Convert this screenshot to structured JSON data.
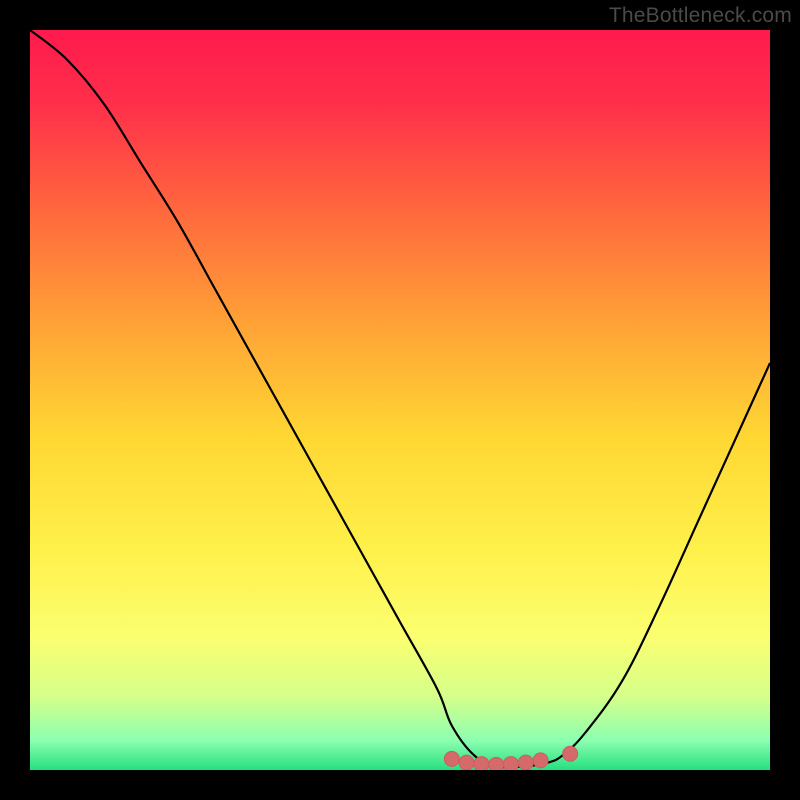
{
  "watermark": "TheBottleneck.com",
  "colors": {
    "background": "#000000",
    "gradient_stops": [
      {
        "offset": 0.0,
        "color": "#ff1a4d"
      },
      {
        "offset": 0.1,
        "color": "#ff2f4a"
      },
      {
        "offset": 0.25,
        "color": "#ff6a3d"
      },
      {
        "offset": 0.4,
        "color": "#ffa336"
      },
      {
        "offset": 0.55,
        "color": "#ffd733"
      },
      {
        "offset": 0.7,
        "color": "#fff04a"
      },
      {
        "offset": 0.82,
        "color": "#fbff70"
      },
      {
        "offset": 0.9,
        "color": "#d6ff8a"
      },
      {
        "offset": 0.96,
        "color": "#8cffb0"
      },
      {
        "offset": 1.0,
        "color": "#25e07f"
      }
    ],
    "curve": "#000000",
    "marker_fill": "#d46a6a",
    "marker_stroke": "#c95f5f"
  },
  "chart_data": {
    "type": "line",
    "title": "",
    "xlabel": "",
    "ylabel": "",
    "xlim": [
      0,
      100
    ],
    "ylim": [
      0,
      100
    ],
    "series": [
      {
        "name": "bottleneck-curve",
        "x": [
          0,
          5,
          10,
          15,
          20,
          25,
          30,
          35,
          40,
          45,
          50,
          55,
          57,
          60,
          63,
          67,
          70,
          72,
          75,
          80,
          85,
          90,
          95,
          100
        ],
        "y": [
          100,
          96,
          90,
          82,
          74,
          65,
          56,
          47,
          38,
          29,
          20,
          11,
          6,
          2,
          0.5,
          0.5,
          1,
          2,
          5,
          12,
          22,
          33,
          44,
          55
        ]
      }
    ],
    "markers": [
      {
        "name": "lowpoint-1",
        "x": 57,
        "y": 1.5
      },
      {
        "name": "lowpoint-2",
        "x": 59,
        "y": 1.0
      },
      {
        "name": "lowpoint-3",
        "x": 61,
        "y": 0.8
      },
      {
        "name": "lowpoint-4",
        "x": 63,
        "y": 0.7
      },
      {
        "name": "lowpoint-5",
        "x": 65,
        "y": 0.8
      },
      {
        "name": "lowpoint-6",
        "x": 67,
        "y": 1.0
      },
      {
        "name": "lowpoint-7",
        "x": 69,
        "y": 1.3
      },
      {
        "name": "lowpoint-8",
        "x": 73,
        "y": 2.2
      }
    ]
  }
}
